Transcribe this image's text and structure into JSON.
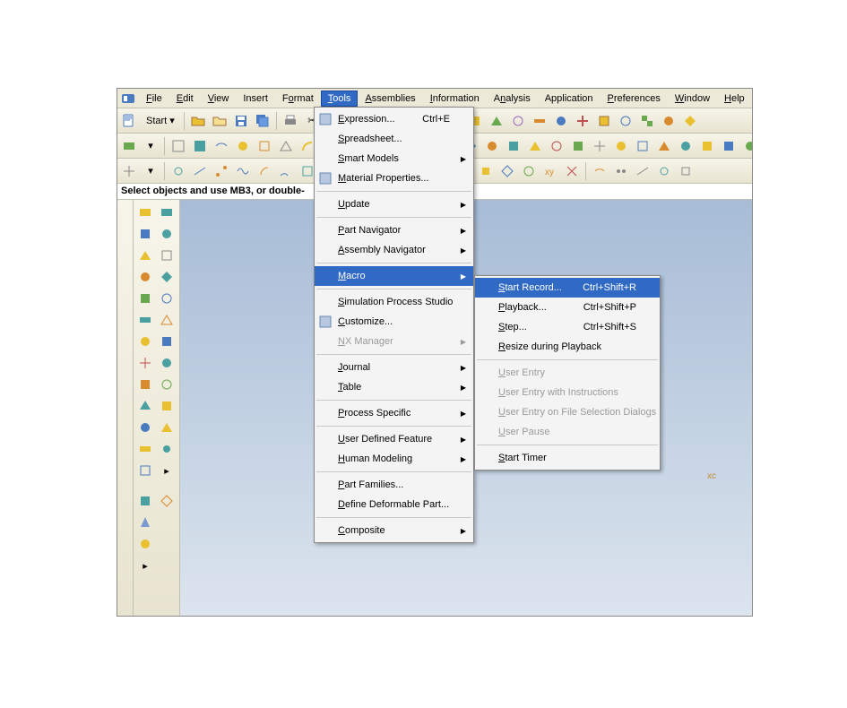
{
  "menubar": {
    "items": [
      "File",
      "Edit",
      "View",
      "Insert",
      "Format",
      "Tools",
      "Assemblies",
      "Information",
      "Analysis",
      "Application",
      "Preferences",
      "Window",
      "Help"
    ],
    "open_index": 5
  },
  "toolbar1": {
    "start_label": "Start",
    "start_arrow": "▾"
  },
  "prompt": "Select objects and use MB3, or double-",
  "axis_label": "xc",
  "tools_menu": {
    "groups": [
      [
        {
          "label": "Expression...",
          "shortcut": "Ctrl+E",
          "icon": "fx-icon"
        },
        {
          "label": "Spreadsheet..."
        },
        {
          "label": "Smart Models",
          "submenu": true
        },
        {
          "label": "Material Properties...",
          "icon": "material-icon"
        }
      ],
      [
        {
          "label": "Update",
          "submenu": true
        }
      ],
      [
        {
          "label": "Part Navigator",
          "submenu": true
        },
        {
          "label": "Assembly Navigator",
          "submenu": true
        }
      ],
      [
        {
          "label": "Macro",
          "submenu": true,
          "highlight": true
        }
      ],
      [
        {
          "label": "Simulation Process Studio"
        },
        {
          "label": "Customize...",
          "icon": "customize-icon"
        },
        {
          "label": "NX Manager",
          "submenu": true,
          "disabled": true
        }
      ],
      [
        {
          "label": "Journal",
          "submenu": true
        },
        {
          "label": "Table",
          "submenu": true
        }
      ],
      [
        {
          "label": "Process Specific",
          "submenu": true
        }
      ],
      [
        {
          "label": "User Defined Feature",
          "submenu": true
        },
        {
          "label": "Human Modeling",
          "submenu": true
        }
      ],
      [
        {
          "label": "Part Families..."
        },
        {
          "label": "Define Deformable Part..."
        }
      ],
      [
        {
          "label": "Composite",
          "submenu": true
        }
      ]
    ]
  },
  "macro_menu": {
    "groups": [
      [
        {
          "label": "Start Record...",
          "shortcut": "Ctrl+Shift+R",
          "highlight": true
        },
        {
          "label": "Playback...",
          "shortcut": "Ctrl+Shift+P"
        },
        {
          "label": "Step...",
          "shortcut": "Ctrl+Shift+S"
        },
        {
          "label": "Resize during Playback"
        }
      ],
      [
        {
          "label": "User Entry",
          "disabled": true
        },
        {
          "label": "User Entry with Instructions",
          "disabled": true
        },
        {
          "label": "User Entry on File Selection Dialogs",
          "disabled": true
        },
        {
          "label": "User Pause",
          "disabled": true
        }
      ],
      [
        {
          "label": "Start Timer"
        }
      ]
    ]
  },
  "icon_colors": {
    "blue": "#4a7abf",
    "orange": "#d88a2e",
    "green": "#6aa84f",
    "yellow": "#e8c030",
    "red": "#c05050",
    "teal": "#4aa0a0",
    "purple": "#9a6ac0",
    "brown": "#a07040",
    "gray": "#888"
  }
}
